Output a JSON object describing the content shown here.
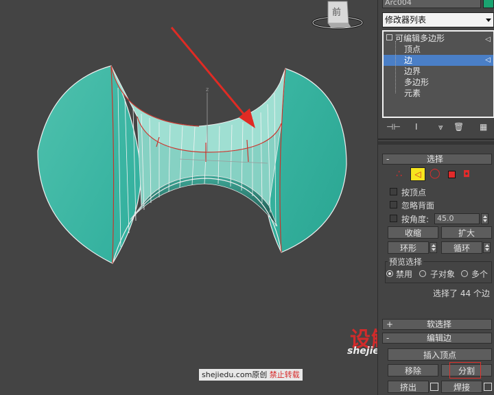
{
  "viewport": {
    "label_view": "前",
    "axis_label": "z"
  },
  "panel": {
    "object_name": "Arc004",
    "object_color": "#1aa370",
    "modifier_list": "修改器列表",
    "stack": [
      {
        "label": "可编辑多边形",
        "selected": false
      },
      {
        "label": "顶点",
        "selected": false
      },
      {
        "label": "边",
        "selected": true
      },
      {
        "label": "边界",
        "selected": false
      },
      {
        "label": "多边形",
        "selected": false
      },
      {
        "label": "元素",
        "selected": false
      }
    ],
    "selection": {
      "rollout_minus": "-",
      "rollout_title": "选择",
      "by_vertex": "按顶点",
      "ignore_backfacing": "忽略背面",
      "by_angle": "按角度:",
      "angle_value": "45.0",
      "shrink": "收缩",
      "grow": "扩大",
      "ring": "环形",
      "loop": "循环",
      "preview_group": "预览选择",
      "preview_disabled": "禁用",
      "preview_subobj": "子对象",
      "preview_multi": "多个",
      "status": "选择了 44 个边"
    },
    "soft_selection": {
      "plus": "+",
      "title": "软选择"
    },
    "edit_edges": {
      "minus": "-",
      "title": "编辑边",
      "insert_vertex": "插入顶点",
      "remove": "移除",
      "split": "分割",
      "extrude": "挤出",
      "weld": "焊接"
    },
    "colors": {
      "accent_selected": "#4a7fc7",
      "highlight_yellow": "#f6e51e",
      "highlight_box": "#e0312b"
    }
  },
  "watermarks": {
    "logo_main": "设解读",
    "logo_url": "shejiedu.com",
    "credit_site": "shejiedu.com原创",
    "credit_warn": "禁止转载"
  }
}
